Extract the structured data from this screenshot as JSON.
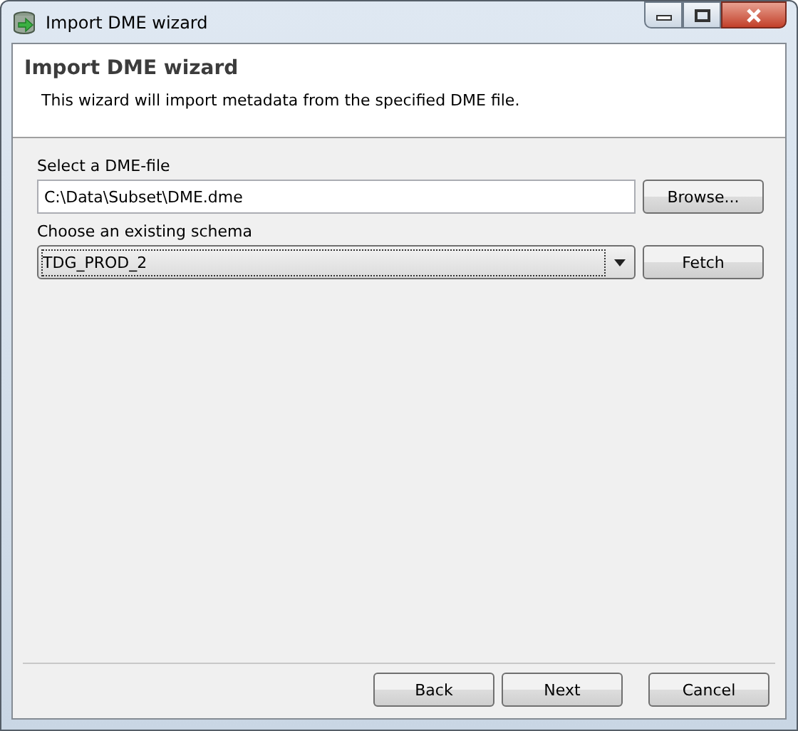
{
  "window": {
    "title": "Import DME wizard"
  },
  "header": {
    "title": "Import DME wizard",
    "description": "This wizard will import metadata from the specified DME file."
  },
  "file": {
    "label": "Select a DME-file",
    "value": "C:\\Data\\Subset\\DME.dme",
    "button": "Browse..."
  },
  "schema": {
    "label": "Choose an existing schema",
    "value": "TDG_PROD_2",
    "button": "Fetch"
  },
  "buttons": [
    "Back",
    "Next",
    "Cancel"
  ]
}
